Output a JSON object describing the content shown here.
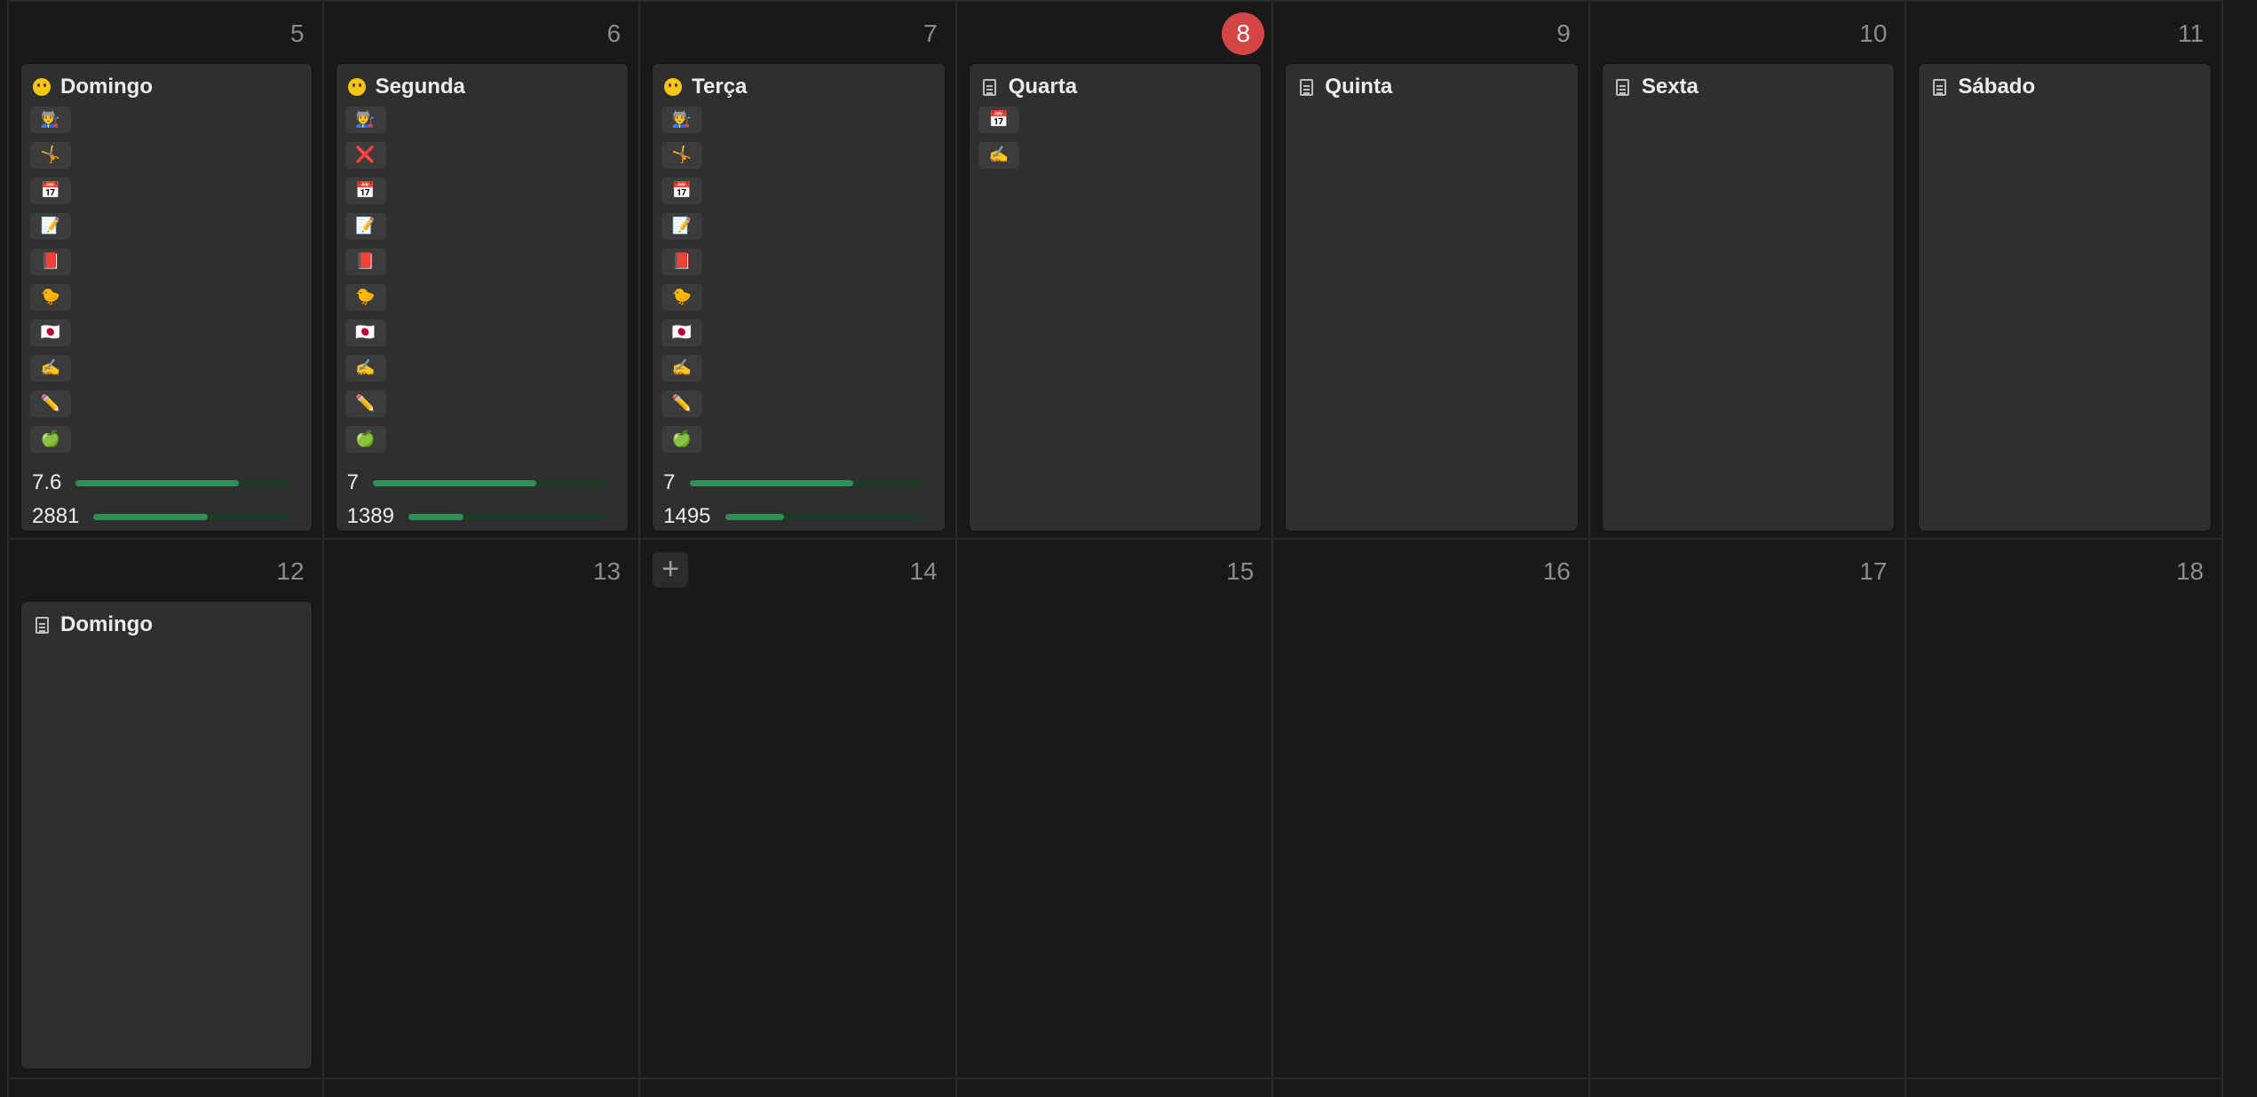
{
  "weeks": [
    {
      "days": [
        {
          "number": "5",
          "today": false,
          "card": {
            "icon": "face-icon",
            "title": "Domingo",
            "tags": [
              "🧑‍🏭",
              "🤸",
              "📅",
              "📝",
              "📕",
              "🐤",
              "🇯🇵",
              "✍️",
              "✏️",
              "🍏"
            ],
            "metrics": [
              {
                "value": "7.6",
                "progress": 0.76
              },
              {
                "value": "2881",
                "progress": 0.58
              }
            ]
          }
        },
        {
          "number": "6",
          "today": false,
          "card": {
            "icon": "face-icon",
            "title": "Segunda",
            "tags": [
              "🧑‍🏭",
              "❌",
              "📅",
              "📝",
              "📕",
              "🐤",
              "🇯🇵",
              "✍️",
              "✏️",
              "🍏"
            ],
            "metrics": [
              {
                "value": "7",
                "progress": 0.7
              },
              {
                "value": "1389",
                "progress": 0.28
              }
            ]
          }
        },
        {
          "number": "7",
          "today": false,
          "card": {
            "icon": "face-icon",
            "title": "Terça",
            "tags": [
              "🧑‍🏭",
              "🤸",
              "📅",
              "📝",
              "📕",
              "🐤",
              "🇯🇵",
              "✍️",
              "✏️",
              "🍏"
            ],
            "metrics": [
              {
                "value": "7",
                "progress": 0.7
              },
              {
                "value": "1495",
                "progress": 0.3
              }
            ]
          }
        },
        {
          "number": "8",
          "today": true,
          "card": {
            "icon": "document-icon",
            "title": "Quarta",
            "tags": [
              "📅",
              "✍️"
            ],
            "metrics": []
          }
        },
        {
          "number": "9",
          "today": false,
          "card": {
            "icon": "document-icon",
            "title": "Quinta",
            "tags": [],
            "metrics": []
          }
        },
        {
          "number": "10",
          "today": false,
          "card": {
            "icon": "document-icon",
            "title": "Sexta",
            "tags": [],
            "metrics": []
          }
        },
        {
          "number": "11",
          "today": false,
          "card": {
            "icon": "document-icon",
            "title": "Sábado",
            "tags": [],
            "metrics": []
          }
        }
      ]
    },
    {
      "days": [
        {
          "number": "12",
          "today": false,
          "card": {
            "icon": "document-icon",
            "title": "Domingo",
            "tags": [],
            "metrics": []
          }
        },
        {
          "number": "13",
          "today": false,
          "card": null
        },
        {
          "number": "14",
          "today": false,
          "add_button": "+",
          "card": null
        },
        {
          "number": "15",
          "today": false,
          "card": null
        },
        {
          "number": "16",
          "today": false,
          "card": null
        },
        {
          "number": "17",
          "today": false,
          "card": null
        },
        {
          "number": "18",
          "today": false,
          "card": null
        }
      ]
    }
  ],
  "colors": {
    "today_badge": "#d64545",
    "progress_fill": "#2f8f57",
    "progress_track": "#1e3a29"
  }
}
